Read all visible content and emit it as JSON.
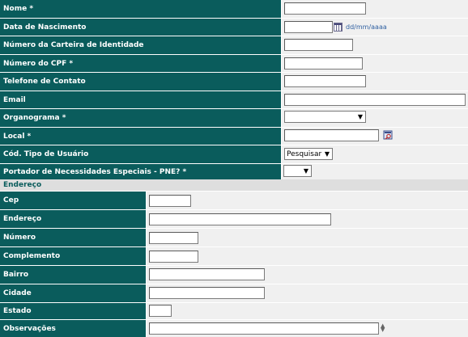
{
  "form": {
    "fields": [
      {
        "label": "Nome *"
      },
      {
        "label": "Data de Nascimento",
        "hint": "dd/mm/aaaa"
      },
      {
        "label": "Número da Carteira de Identidade"
      },
      {
        "label": "Número do CPF *"
      },
      {
        "label": "Telefone de Contato"
      },
      {
        "label": "Email"
      },
      {
        "label": "Organograma *"
      },
      {
        "label": "Local *"
      },
      {
        "label": "Cód. Tipo de Usuário",
        "selected": "Pesquisar"
      },
      {
        "label": "Portador de Necessidades Especiais - PNE? *",
        "selected": ""
      }
    ]
  },
  "address": {
    "section_title": "Endereço",
    "fields": [
      {
        "label": "Cep"
      },
      {
        "label": "Endereço"
      },
      {
        "label": "Número"
      },
      {
        "label": "Complemento"
      },
      {
        "label": "Bairro"
      },
      {
        "label": "Cidade"
      },
      {
        "label": "Estado"
      },
      {
        "label": "Observações"
      }
    ]
  },
  "colors": {
    "label_bg": "#0a5c5c",
    "label_text": "#ffffff",
    "field_bg": "#f0f0f0",
    "section_bg": "#dedede",
    "hint_text": "#2e5fa0"
  },
  "icons": {
    "calendar": "calendar-icon",
    "search": "search-icon",
    "dropdown": "chevron-down-icon"
  }
}
